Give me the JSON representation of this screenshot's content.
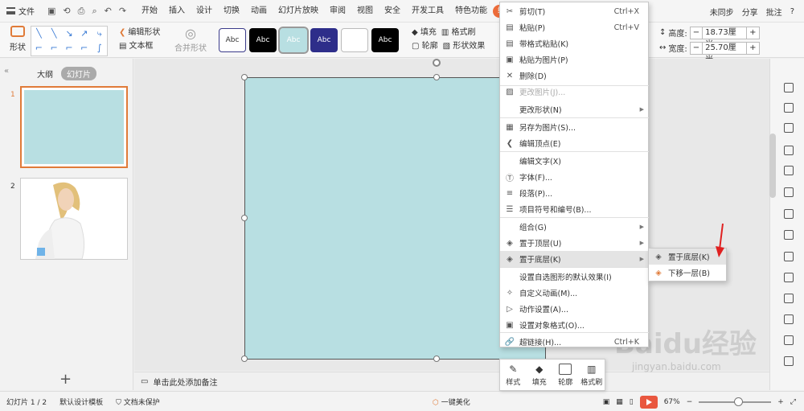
{
  "menubar": {
    "file_label": "文件",
    "tabs": [
      "开始",
      "插入",
      "设计",
      "切换",
      "动画",
      "幻灯片放映",
      "审阅",
      "视图",
      "安全",
      "开发工具",
      "特色功能",
      "绘图"
    ],
    "active_tab": "绘图",
    "right": {
      "sync": "未同步",
      "share": "分享",
      "comment": "批注",
      "help": "?"
    }
  },
  "ribbon": {
    "shape_label": "形状",
    "edit_shape": "编辑形状",
    "textbox": "文本框",
    "merge_shape": "合并形状",
    "style_label": "Abc",
    "fill": "填充",
    "format_painter": "格式刷",
    "outline": "轮廓",
    "shape_effect": "形状效果",
    "height_label": "高度:",
    "height_value": "18.73厘米",
    "width_label": "宽度:",
    "width_value": "25.70厘米"
  },
  "leftpanel": {
    "tab_outline": "大纲",
    "tab_slides": "幻灯片",
    "slides": [
      {
        "num": "1"
      },
      {
        "num": "2"
      }
    ],
    "add_icon": "+"
  },
  "notes": {
    "placeholder": "单击此处添加备注"
  },
  "statusbar": {
    "slide_info": "幻灯片 1 / 2",
    "template": "默认设计模板",
    "protect": "文档未保护",
    "beautify": "一键美化",
    "zoom": "67%"
  },
  "context_menu": {
    "items": [
      {
        "icon": "✂",
        "label": "剪切(T)",
        "shortcut": "Ctrl+X"
      },
      {
        "icon": "▤",
        "label": "粘贴(P)",
        "shortcut": "Ctrl+V"
      },
      {
        "icon": "▤",
        "label": "带格式粘贴(K)",
        "shortcut": ""
      },
      {
        "icon": "▣",
        "label": "粘贴为图片(P)",
        "shortcut": ""
      },
      {
        "icon": "✕",
        "label": "删除(D)",
        "shortcut": ""
      },
      {
        "icon": "▨",
        "label": "更改图片(J)...",
        "shortcut": "",
        "disabled": true
      },
      {
        "icon": "",
        "label": "更改形状(N)",
        "shortcut": "",
        "submenu": true
      },
      {
        "icon": "▦",
        "label": "另存为图片(S)...",
        "shortcut": ""
      },
      {
        "icon": "❮",
        "label": "编辑顶点(E)",
        "shortcut": ""
      },
      {
        "icon": "",
        "label": "编辑文字(X)",
        "shortcut": ""
      },
      {
        "icon": "Ⓣ",
        "label": "字体(F)...",
        "shortcut": ""
      },
      {
        "icon": "≡",
        "label": "段落(P)...",
        "shortcut": ""
      },
      {
        "icon": "☰",
        "label": "项目符号和编号(B)...",
        "shortcut": ""
      },
      {
        "icon": "",
        "label": "组合(G)",
        "shortcut": "",
        "submenu": true
      },
      {
        "icon": "◈",
        "label": "置于顶层(U)",
        "shortcut": "",
        "submenu": true
      },
      {
        "icon": "◈",
        "label": "置于底层(K)",
        "shortcut": "",
        "submenu": true,
        "highlight": true
      },
      {
        "icon": "",
        "label": "设置自选图形的默认效果(I)",
        "shortcut": ""
      },
      {
        "icon": "✧",
        "label": "自定义动画(M)...",
        "shortcut": ""
      },
      {
        "icon": "▷",
        "label": "动作设置(A)...",
        "shortcut": ""
      },
      {
        "icon": "▣",
        "label": "设置对象格式(O)...",
        "shortcut": ""
      },
      {
        "icon": "🔗",
        "label": "超链接(H)...",
        "shortcut": "Ctrl+K"
      }
    ]
  },
  "submenu": {
    "items": [
      {
        "label": "置于底层(K)"
      },
      {
        "label": "下移一层(B)"
      }
    ]
  },
  "minibar": {
    "style": "样式",
    "fill": "填充",
    "outline": "轮廓",
    "painter": "格式刷"
  },
  "watermark": {
    "brand": "Baidu经验",
    "url": "jingyan.baidu.com"
  }
}
